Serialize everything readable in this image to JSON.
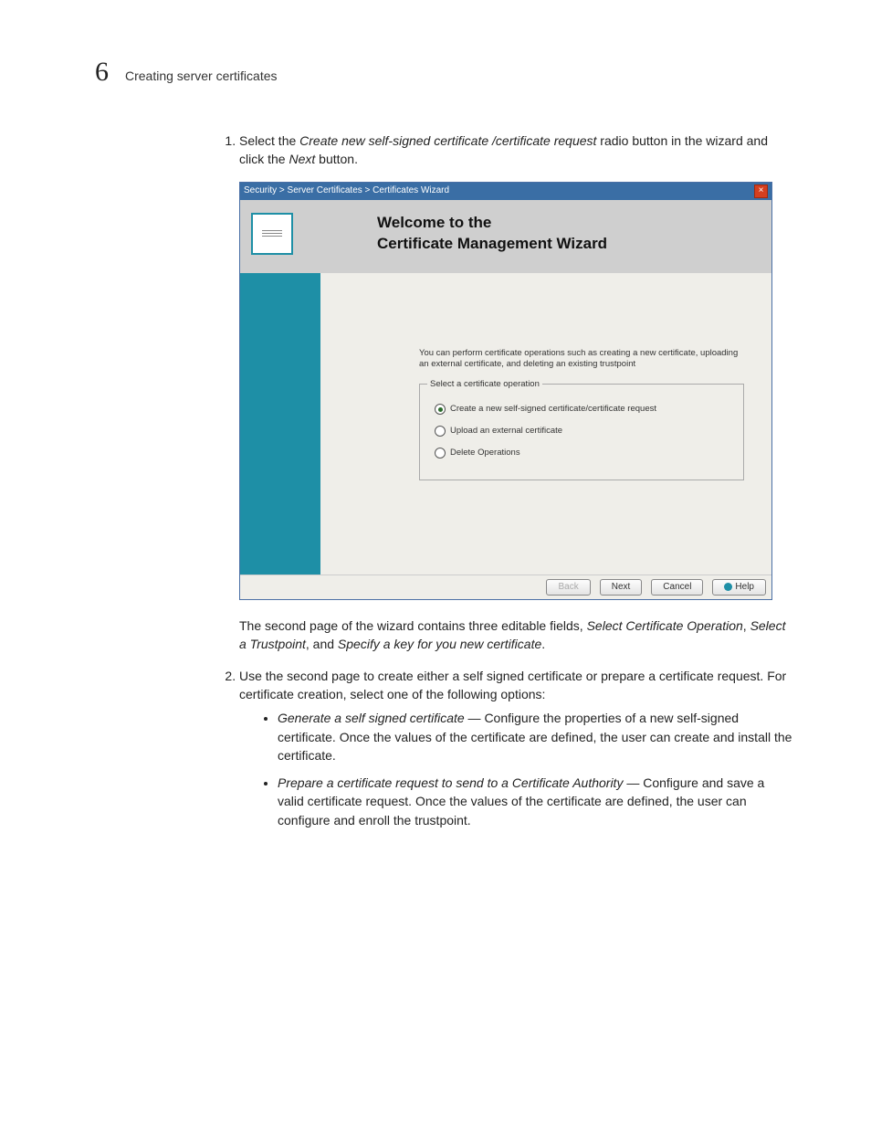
{
  "header": {
    "chapter_number": "6",
    "chapter_title": "Creating server certificates"
  },
  "step1": {
    "pre": "Select the ",
    "italic1": "Create new self-signed certificate /certificate request",
    "mid": " radio button in the wizard and click the ",
    "italic2": "Next",
    "post": " button."
  },
  "wizard": {
    "breadcrumb": "Security > Server Certificates > Certificates Wizard",
    "title_line1": "Welcome to the",
    "title_line2": "Certificate Management Wizard",
    "description": "You can perform certificate operations such as creating a new certificate, uploading an external certificate, and deleting an existing trustpoint",
    "fieldset_legend": "Select a certificate operation",
    "options": {
      "opt1": "Create a new self-signed certificate/certificate request",
      "opt2": "Upload an external certificate",
      "opt3": "Delete Operations"
    },
    "buttons": {
      "back": "Back",
      "next": "Next",
      "cancel": "Cancel",
      "help": "Help"
    }
  },
  "para2": {
    "pre": "The second page of the wizard contains three editable fields, ",
    "i1": "Select Certificate Operation",
    "c1": ", ",
    "i2": "Select a Trustpoint",
    "c2": ", and ",
    "i3": "Specify a key for you new certificate",
    "post": "."
  },
  "step2": "Use the second page to create either a self signed certificate or prepare a certificate request. For certificate creation, select one of the following options:",
  "bullet1": {
    "title": "Generate a self signed certificate",
    "body": " — Configure the properties of a new self-signed certificate. Once the values of the certificate are defined, the user can create and install the certificate."
  },
  "bullet2": {
    "title": "Prepare a certificate request to send to a Certificate Authority",
    "body": " — Configure and save a valid certificate request. Once the values of the certificate are defined, the user can configure and enroll the trustpoint."
  }
}
